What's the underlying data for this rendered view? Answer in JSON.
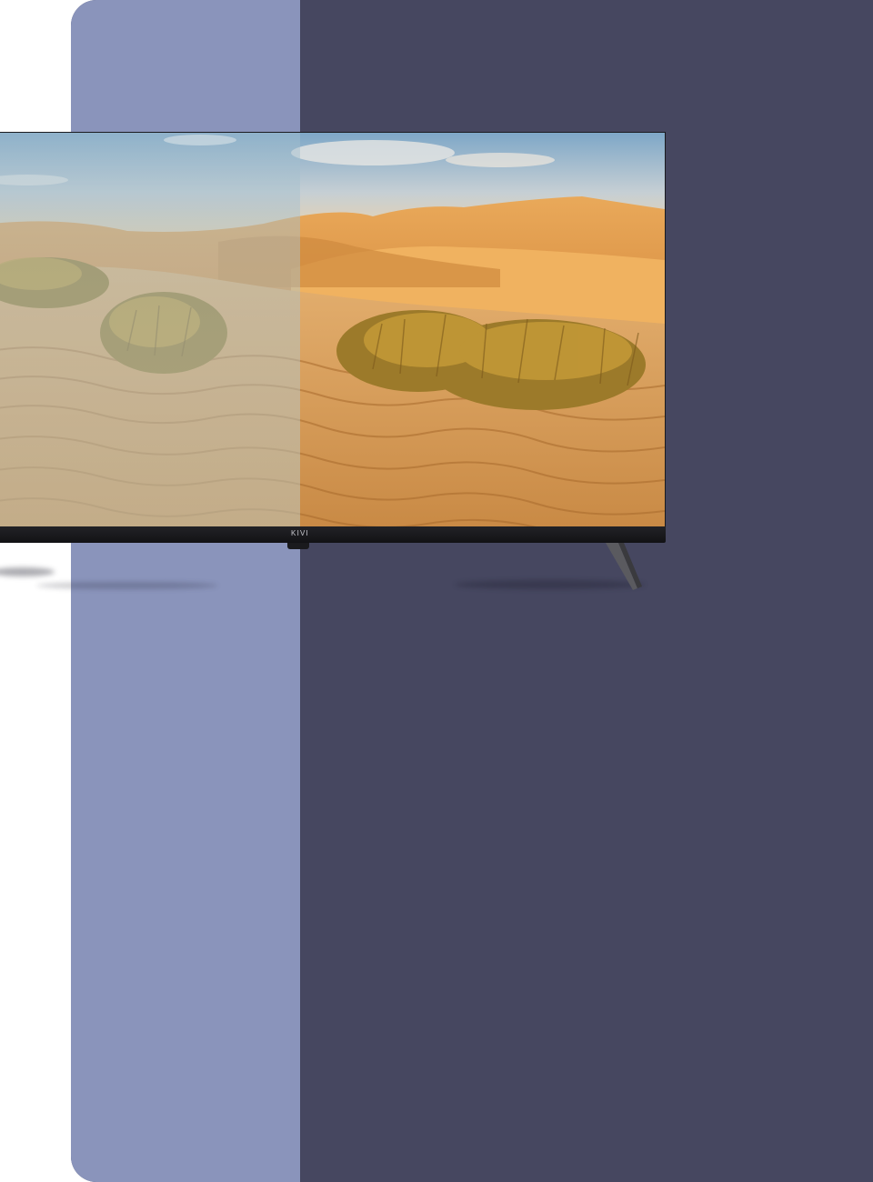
{
  "tv": {
    "brand_logo": "KIVI"
  },
  "colors": {
    "panel_left": "#8a94bb",
    "panel_right": "#464760",
    "page_background": "#ffffff"
  },
  "icons": {
    "tv": "tv-icon"
  }
}
